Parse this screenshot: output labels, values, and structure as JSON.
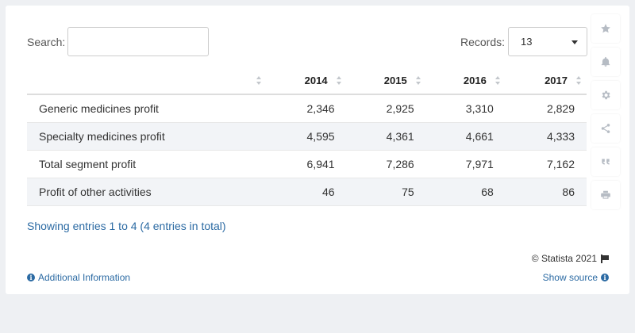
{
  "search": {
    "label": "Search:",
    "value": ""
  },
  "records": {
    "label": "Records:",
    "value": "13"
  },
  "table": {
    "headers": [
      "",
      "2014",
      "2015",
      "2016",
      "2017"
    ],
    "rows": [
      [
        "Generic medicines profit",
        "2,346",
        "2,925",
        "3,310",
        "2,829"
      ],
      [
        "Specialty medicines profit",
        "4,595",
        "4,361",
        "4,661",
        "4,333"
      ],
      [
        "Total segment profit",
        "6,941",
        "7,286",
        "7,971",
        "7,162"
      ],
      [
        "Profit of other activities",
        "46",
        "75",
        "68",
        "86"
      ]
    ]
  },
  "footer": {
    "entries": "Showing entries 1 to 4 (4 entries in total)",
    "copyright": "© Statista 2021",
    "additional_info": "Additional Information",
    "show_source": "Show source"
  },
  "sidebar_icons": [
    "star-icon",
    "bell-icon",
    "gear-icon",
    "share-icon",
    "quote-icon",
    "print-icon"
  ],
  "colors": {
    "link": "#2b6aa3",
    "stripe": "#f2f4f7",
    "background": "#eef0f3"
  }
}
